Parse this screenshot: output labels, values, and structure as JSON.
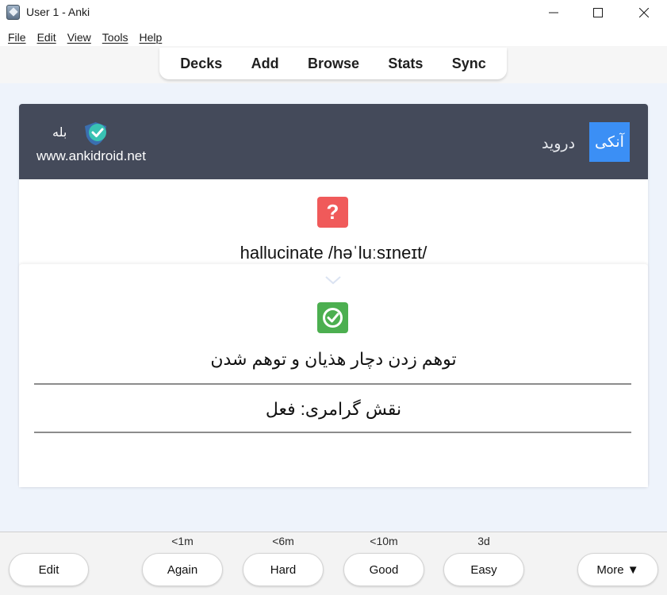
{
  "window": {
    "title": "User 1 - Anki"
  },
  "menu": [
    "File",
    "Edit",
    "View",
    "Tools",
    "Help"
  ],
  "toolbar": [
    "Decks",
    "Add",
    "Browse",
    "Stats",
    "Sync"
  ],
  "card": {
    "header": {
      "brand_box": "آنکی",
      "brand_text": "دروید",
      "yes_label": "بله",
      "site_url": "www.ankidroid.net"
    },
    "front": "hallucinate /həˈluːsɪneɪt/",
    "back": "توهم زدن دچار هذیان و توهم شدن",
    "grammar": "نقش گرامری: فعل"
  },
  "bottom": {
    "edit": "Edit",
    "answers": [
      {
        "interval": "<1m",
        "label": "Again"
      },
      {
        "interval": "<6m",
        "label": "Hard"
      },
      {
        "interval": "<10m",
        "label": "Good"
      },
      {
        "interval": "3d",
        "label": "Easy"
      }
    ],
    "more": "More ▼"
  },
  "colors": {
    "header": "#444a5a",
    "brand_box": "#3b8ff5",
    "question_icon": "#f05a5a",
    "answer_icon": "#4caf50",
    "background": "#eef3fb"
  }
}
